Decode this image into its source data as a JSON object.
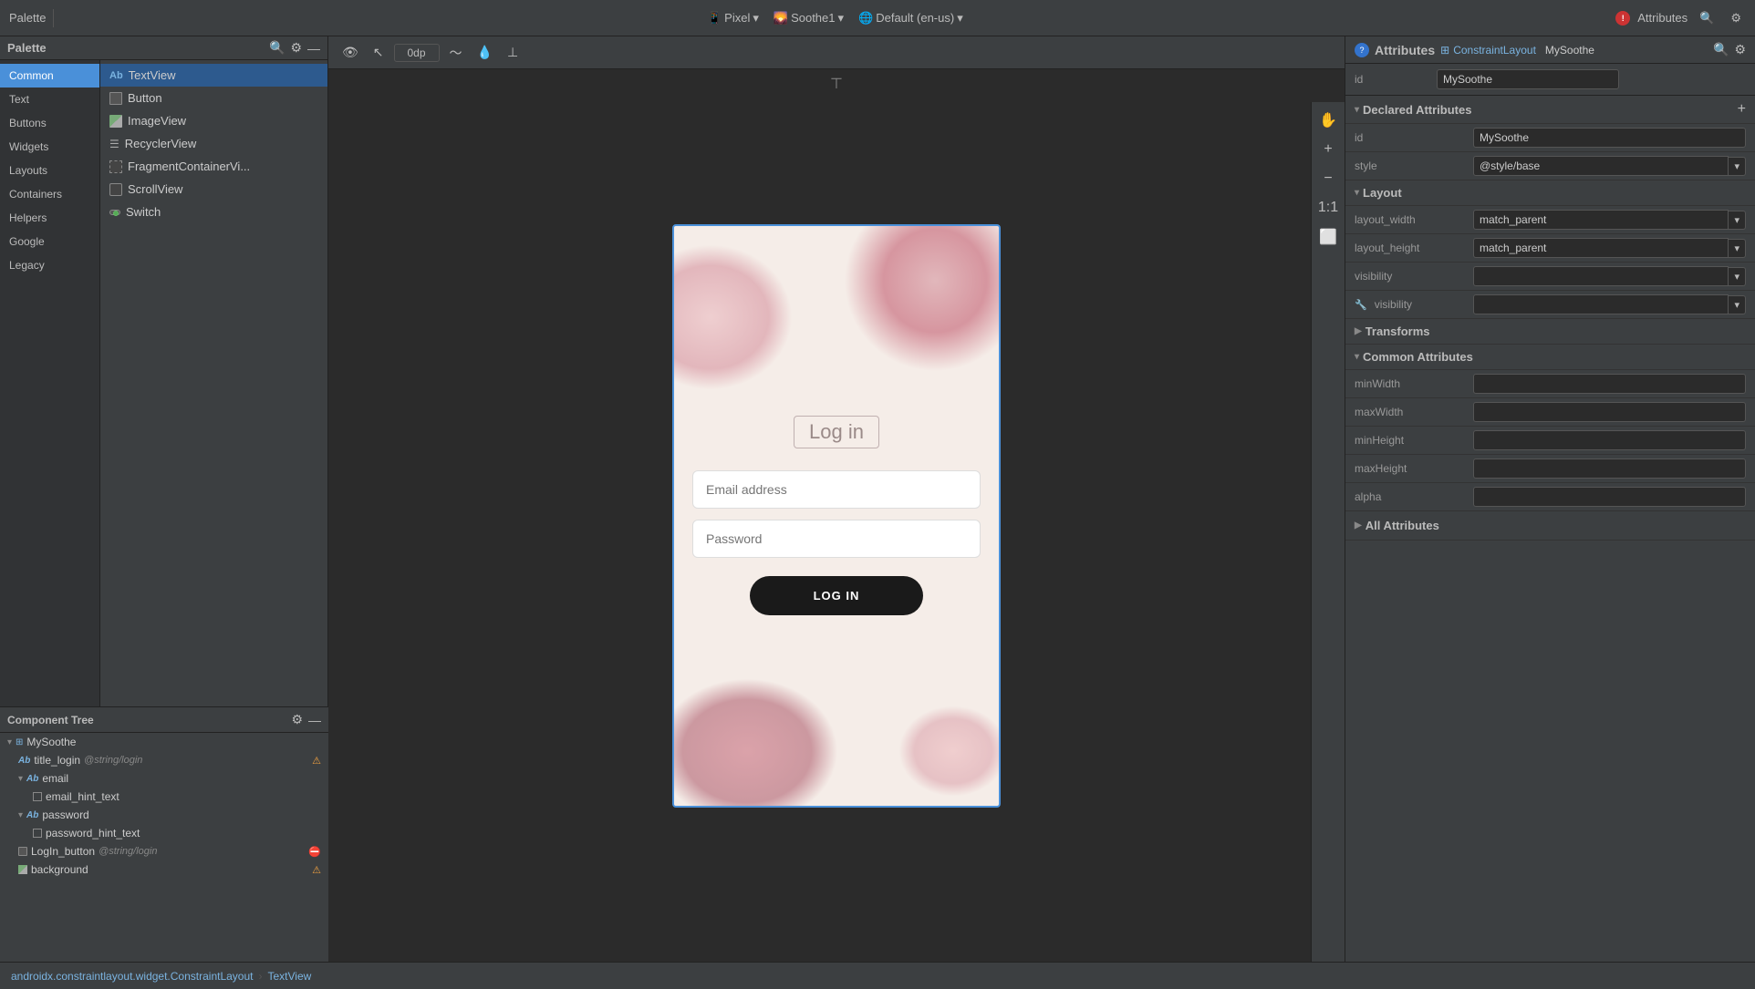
{
  "topbar": {
    "palette_label": "Palette",
    "pixel_label": "Pixel",
    "soothe1_label": "Soothe1",
    "locale_label": "Default (en-us)",
    "attributes_label": "Attributes",
    "dp_value": "0dp",
    "search_icon": "🔍",
    "gear_icon": "⚙",
    "minus_icon": "—",
    "chevron_down": "▾"
  },
  "palette": {
    "header": "Palette",
    "sidebar_items": [
      {
        "id": "common",
        "label": "Common",
        "active": true
      },
      {
        "id": "text",
        "label": "Text"
      },
      {
        "id": "buttons",
        "label": "Buttons"
      },
      {
        "id": "widgets",
        "label": "Widgets"
      },
      {
        "id": "layouts",
        "label": "Layouts"
      },
      {
        "id": "containers",
        "label": "Containers"
      },
      {
        "id": "helpers",
        "label": "Helpers"
      },
      {
        "id": "google",
        "label": "Google"
      },
      {
        "id": "legacy",
        "label": "Legacy"
      }
    ],
    "list_items": [
      {
        "id": "textview",
        "label": "TextView",
        "icon": "text",
        "selected": true
      },
      {
        "id": "button",
        "label": "Button",
        "icon": "box"
      },
      {
        "id": "imageview",
        "label": "ImageView",
        "icon": "img"
      },
      {
        "id": "recyclerview",
        "label": "RecyclerView",
        "icon": "list"
      },
      {
        "id": "fragmentcontainerview",
        "label": "FragmentContainerVi...",
        "icon": "frag"
      },
      {
        "id": "scrollview",
        "label": "ScrollView",
        "icon": "box"
      },
      {
        "id": "switch",
        "label": "Switch",
        "icon": "switch"
      }
    ]
  },
  "component_tree": {
    "header": "Component Tree",
    "items": [
      {
        "id": "mysoothe",
        "label": "MySoothe",
        "icon": "constraint",
        "indent": 0,
        "expand": true
      },
      {
        "id": "title_login",
        "label": "title_login",
        "icon": "text",
        "indent": 1,
        "string": "@string/login",
        "warn": true
      },
      {
        "id": "email",
        "label": "email",
        "icon": "text",
        "indent": 1,
        "expand": true
      },
      {
        "id": "email_hint_text",
        "label": "email_hint_text",
        "icon": "view",
        "indent": 2
      },
      {
        "id": "password",
        "label": "password",
        "icon": "text",
        "indent": 1,
        "expand": true
      },
      {
        "id": "password_hint_text",
        "label": "password_hint_text",
        "icon": "view",
        "indent": 2
      },
      {
        "id": "login_button",
        "label": "LogIn_button",
        "icon": "box",
        "indent": 1,
        "string": "@string/login",
        "error": true
      },
      {
        "id": "background",
        "label": "background",
        "icon": "img",
        "indent": 1,
        "warn": true
      }
    ]
  },
  "phone": {
    "title": "Log in",
    "email_placeholder": "Email address",
    "password_placeholder": "Password",
    "login_button": "LOG IN"
  },
  "attributes": {
    "header": "Attributes",
    "component_type": "ConstraintLayout",
    "component_name": "MySoothe",
    "id_label": "id",
    "id_value": "MySoothe",
    "declared_section": "Declared Attributes",
    "declared_items": [
      {
        "label": "id",
        "value": "MySoothe",
        "type": "text"
      },
      {
        "label": "style",
        "value": "@style/base",
        "type": "select"
      }
    ],
    "layout_section": "Layout",
    "layout_items": [
      {
        "label": "layout_width",
        "value": "match_parent",
        "type": "select"
      },
      {
        "label": "layout_height",
        "value": "match_parent",
        "type": "select"
      },
      {
        "label": "visibility",
        "value": "",
        "type": "select"
      },
      {
        "label": "visibility",
        "value": "",
        "type": "select",
        "wrench": true
      }
    ],
    "transforms_section": "Transforms",
    "common_section": "Common Attributes",
    "common_items": [
      {
        "label": "minWidth",
        "value": "",
        "type": "input"
      },
      {
        "label": "maxWidth",
        "value": "",
        "type": "input"
      },
      {
        "label": "minHeight",
        "value": "",
        "type": "input"
      },
      {
        "label": "maxHeight",
        "value": "",
        "type": "input"
      },
      {
        "label": "alpha",
        "value": "",
        "type": "input"
      }
    ],
    "all_section": "All Attributes"
  },
  "bottom_bar": {
    "breadcrumb_widget": "androidx.constraintlayout.widget.ConstraintLayout",
    "breadcrumb_sep": "›",
    "breadcrumb_view": "TextView"
  },
  "design_tools": {
    "zoom_label": "1:1"
  }
}
